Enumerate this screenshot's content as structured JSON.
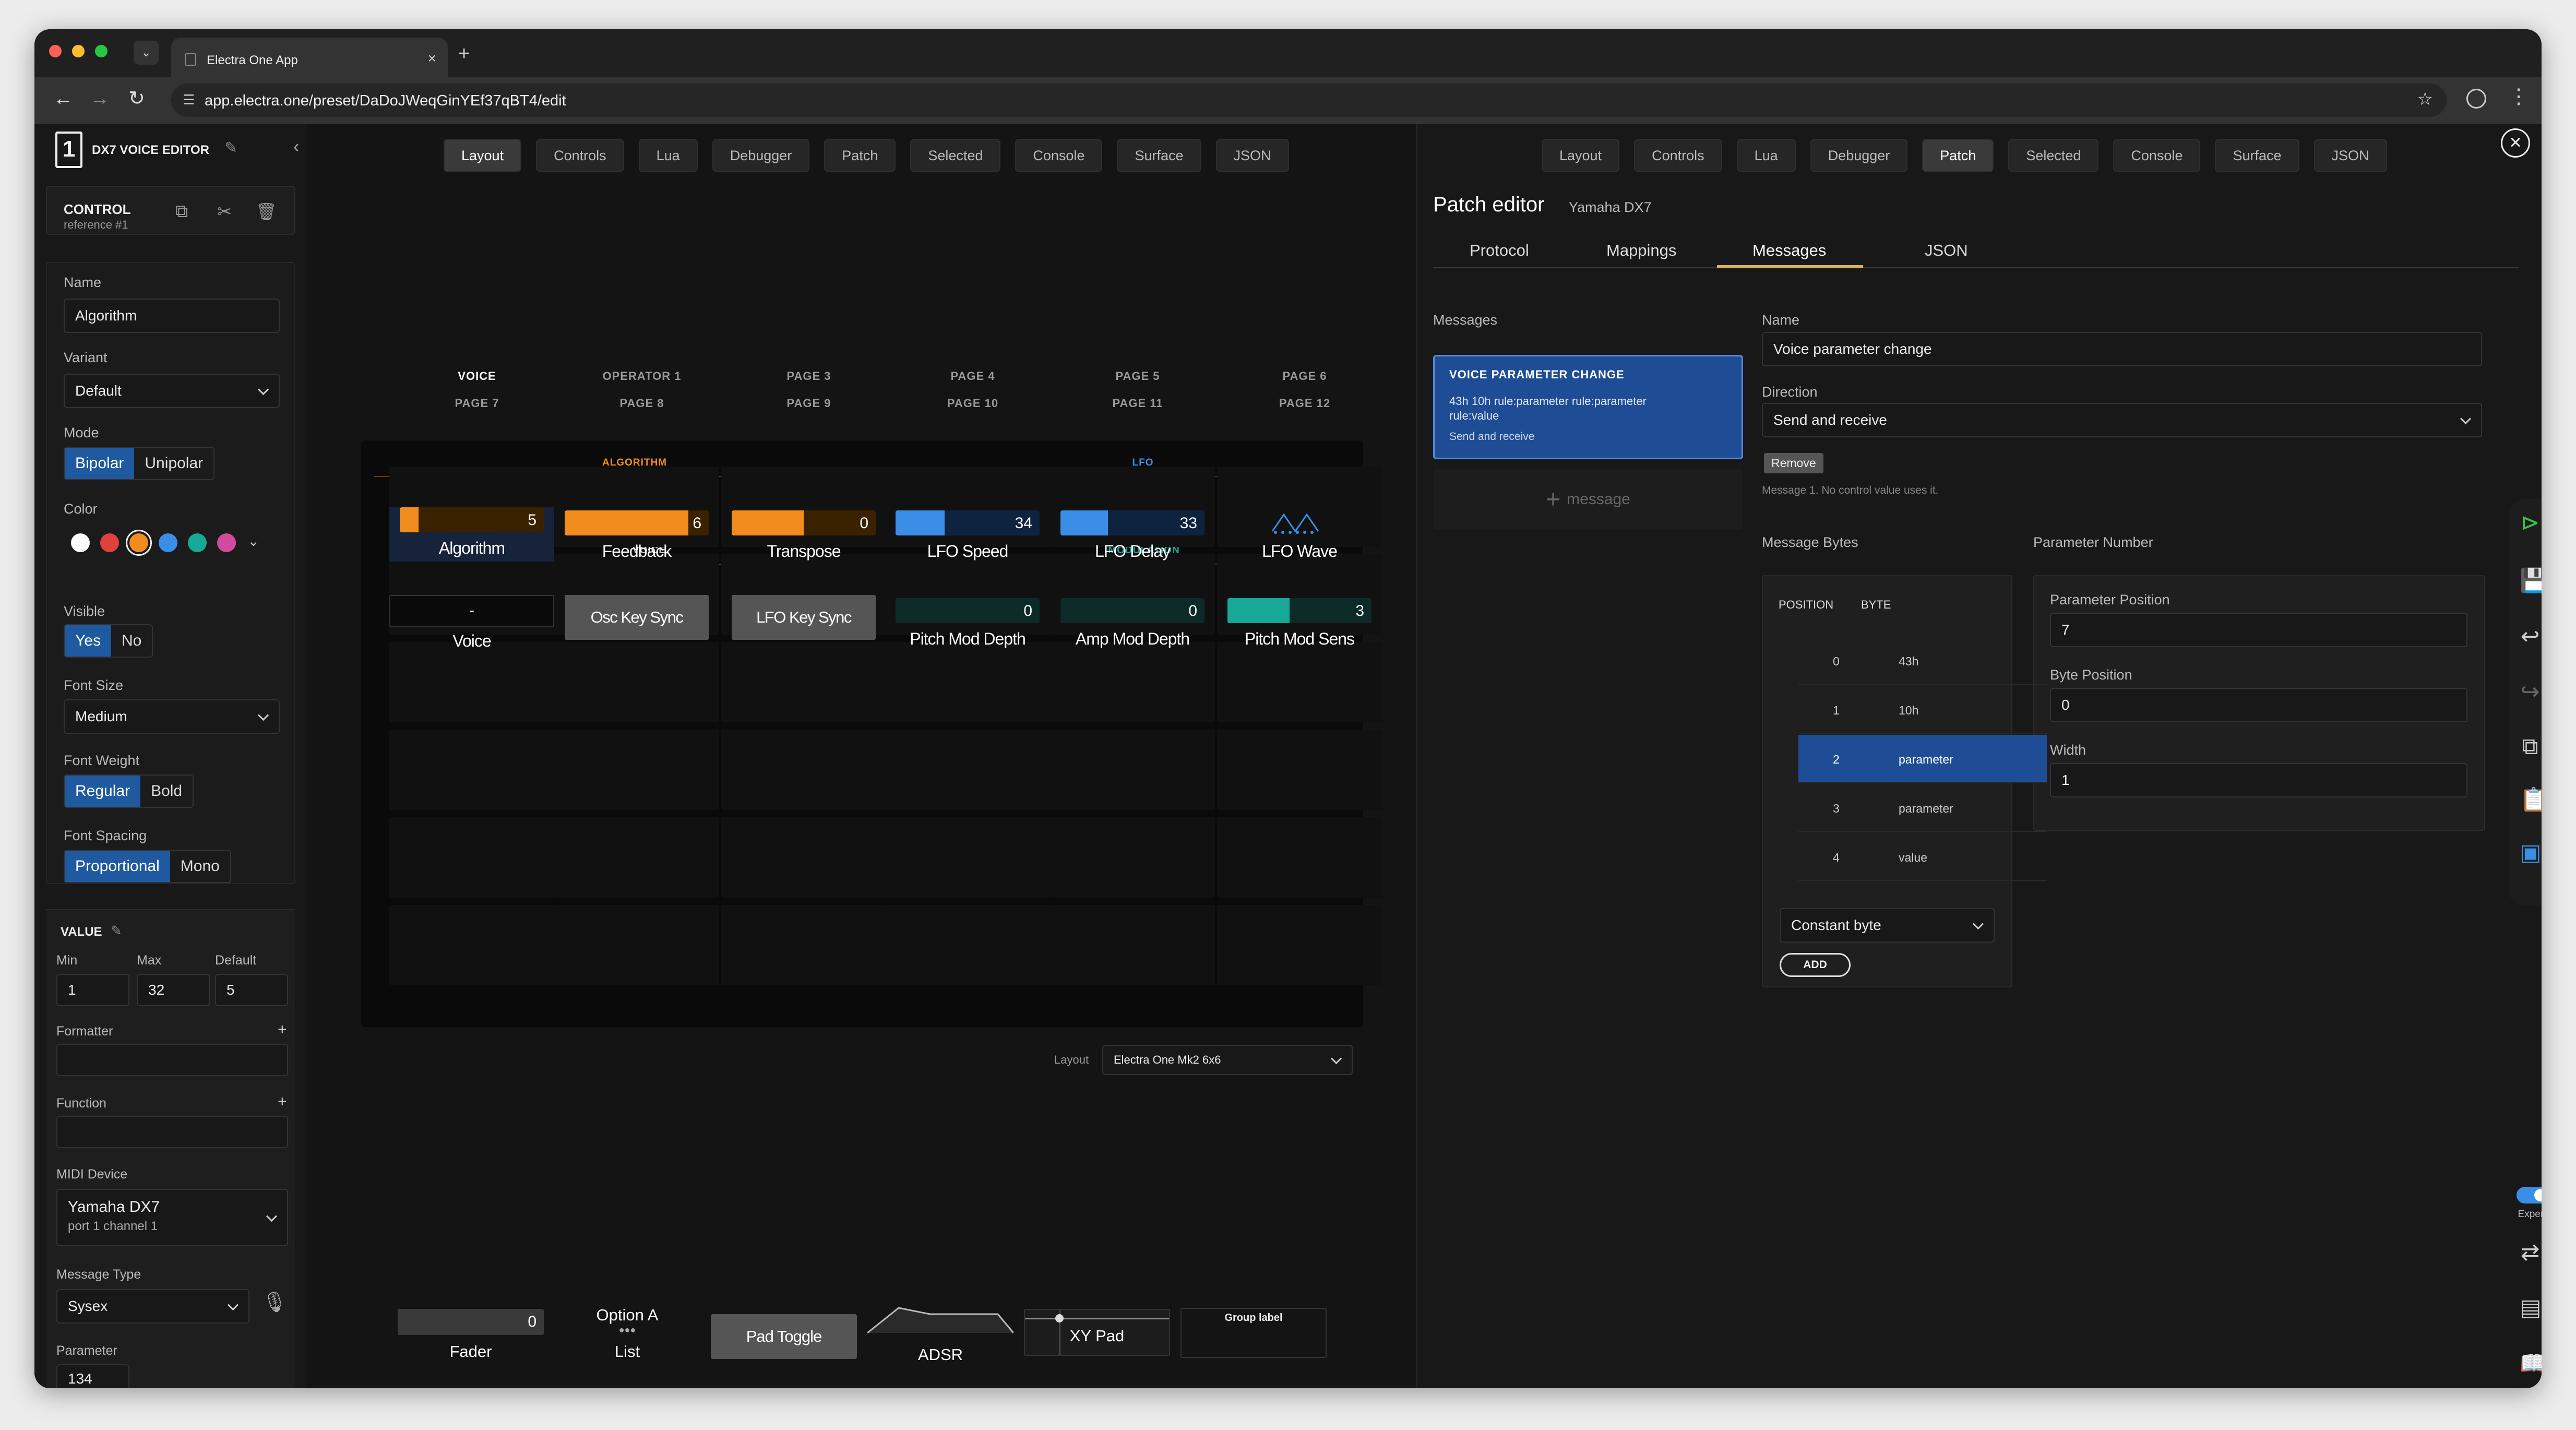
{
  "browser": {
    "tab_title": "Electra One App",
    "url": "app.electra.one/preset/DaDoJWeqGinYEf37qBT4/edit"
  },
  "sidebar": {
    "title": "DX7 VOICE EDITOR",
    "control_heading": "CONTROL",
    "control_ref": "reference #1",
    "name_label": "Name",
    "name_value": "Algorithm",
    "variant_label": "Variant",
    "variant_value": "Default",
    "mode_label": "Mode",
    "mode_options": [
      "Bipolar",
      "Unipolar"
    ],
    "color_label": "Color",
    "colors": [
      "#ffffff",
      "#e0413c",
      "#f28c1e",
      "#3a8ee6",
      "#17a897",
      "#d04aa0"
    ],
    "visible_label": "Visible",
    "visible_options": [
      "Yes",
      "No"
    ],
    "fontsize_label": "Font Size",
    "fontsize_value": "Medium",
    "fontweight_label": "Font Weight",
    "fontweight_options": [
      "Regular",
      "Bold"
    ],
    "fontspacing_label": "Font Spacing",
    "fontspacing_options": [
      "Proportional",
      "Mono"
    ],
    "value_heading": "VALUE",
    "min_label": "Min",
    "max_label": "Max",
    "default_label": "Default",
    "min": "1",
    "max": "32",
    "default": "5",
    "formatter_label": "Formatter",
    "function_label": "Function",
    "plus": "+",
    "midi_label": "MIDI Device",
    "midi_device": "Yamaha DX7",
    "midi_port": "port 1 channel 1",
    "msgtype_label": "Message Type",
    "msgtype_value": "Sysex",
    "parameter_label": "Parameter",
    "parameter_value": "134"
  },
  "nav_tabs": [
    "Layout",
    "Controls",
    "Lua",
    "Debugger",
    "Patch",
    "Selected",
    "Console",
    "Surface",
    "JSON"
  ],
  "pages": {
    "top": [
      "VOICE",
      "OPERATOR 1",
      "PAGE 3",
      "PAGE 4",
      "PAGE 5",
      "PAGE 6"
    ],
    "bottom": [
      "PAGE 7",
      "PAGE 8",
      "PAGE 9",
      "PAGE 10",
      "PAGE 11",
      "PAGE 12"
    ]
  },
  "groups": {
    "algorithm": "ALGORITHM",
    "lfo": "LFO",
    "voice": "VOICE",
    "modulation": "MODULATION"
  },
  "controls": {
    "row1": [
      {
        "name": "Algorithm",
        "value": "5",
        "level": 0.13,
        "color": "#f28c1e",
        "bg": "#3a2200"
      },
      {
        "name": "Feedback",
        "value": "6",
        "level": 0.86,
        "color": "#f28c1e",
        "bg": "#3a2200"
      },
      {
        "name": "Transpose",
        "value": "0",
        "level": 0.5,
        "color": "#f28c1e",
        "bg": "#3a2200"
      },
      {
        "name": "LFO Speed",
        "value": "34",
        "level": 0.34,
        "color": "#3a8ee6",
        "bg": "#0e2340"
      },
      {
        "name": "LFO Delay",
        "value": "33",
        "level": 0.33,
        "color": "#3a8ee6",
        "bg": "#0e2340"
      },
      {
        "name": "LFO Wave"
      }
    ],
    "row2": [
      {
        "name": "Voice",
        "value": "-"
      },
      {
        "name": "Osc Key Sync"
      },
      {
        "name": "LFO Key Sync"
      },
      {
        "name": "Pitch Mod Depth",
        "value": "0",
        "level": 0,
        "color": "#17a897",
        "bg": "#0c2a27"
      },
      {
        "name": "Amp Mod Depth",
        "value": "0",
        "level": 0,
        "color": "#17a897",
        "bg": "#0c2a27"
      },
      {
        "name": "Pitch Mod Sens",
        "value": "3",
        "level": 0.43,
        "color": "#17a897",
        "bg": "#0c2a27"
      }
    ]
  },
  "layout_select": {
    "label": "Layout",
    "value": "Electra One Mk2 6x6"
  },
  "palette": {
    "fader": "Fader",
    "fader_value": "0",
    "list_value": "Option A",
    "list": "List",
    "pad": "Pad Toggle",
    "adsr": "ADSR",
    "xy": "XY Pad",
    "group": "Group label"
  },
  "patch": {
    "title": "Patch editor",
    "subtitle": "Yamaha DX7",
    "tabs": [
      "Protocol",
      "Mappings",
      "Messages",
      "JSON"
    ],
    "messages_label": "Messages",
    "msg_card": {
      "title": "VOICE PARAMETER CHANGE",
      "body": "43h 10h rule:parameter rule:parameter rule:value",
      "foot": "Send and receive"
    },
    "add_message": "message",
    "name_label": "Name",
    "name_value": "Voice parameter change",
    "direction_label": "Direction",
    "direction_value": "Send and receive",
    "remove": "Remove",
    "note": "Message 1. No control value uses it.",
    "bytes_label": "Message Bytes",
    "pos_header": "POSITION",
    "byte_header": "BYTE",
    "rows": [
      {
        "p": "0",
        "b": "43h"
      },
      {
        "p": "1",
        "b": "10h"
      },
      {
        "p": "2",
        "b": "parameter"
      },
      {
        "p": "3",
        "b": "parameter"
      },
      {
        "p": "4",
        "b": "value"
      }
    ],
    "byte_type": "Constant byte",
    "add": "ADD",
    "param_number_label": "Parameter Number",
    "param_pos_label": "Parameter Position",
    "param_pos": "7",
    "byte_pos_label": "Byte Position",
    "byte_pos": "0",
    "width_label": "Width",
    "width": "1",
    "expert": "Expert"
  }
}
